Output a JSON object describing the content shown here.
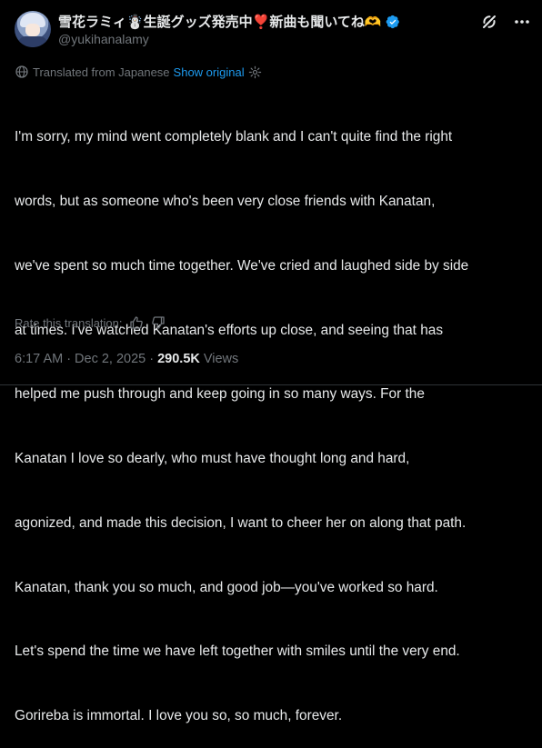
{
  "author": {
    "display_name": "雪花ラミィ☃️生誕グッズ発売中❣️新曲も聞いてね🫶",
    "handle": "@yukihanalamy",
    "verified": true,
    "avatar": "avatar-image"
  },
  "header_actions": [
    {
      "name": "grok-icon",
      "label": ""
    },
    {
      "name": "more-icon",
      "label": ""
    }
  ],
  "translation": {
    "label": "Translated from Japanese",
    "show_original": "Show original",
    "icon": "globe-icon",
    "settings_icon": "gear-icon"
  },
  "tweet": {
    "lines": [
      "I'm sorry, my mind went completely blank and I can't quite find the right",
      "words, but as someone who's been very close friends with Kanatan,",
      "we've spent so much time together. We've cried and laughed side by side",
      "at times. I've watched Kanatan's efforts up close, and seeing that has",
      "helped me push through and keep going in so many ways. For the",
      "Kanatan I love so dearly, who must have thought long and hard,",
      "agonized, and made this decision, I want to cheer her on along that path.",
      "Kanatan, thank you so much, and good job—you've worked so hard.",
      "Let's spend the time we have left together with smiles until the very end.",
      "Gorireba is immortal. I love you so, so much, forever."
    ]
  },
  "rate": {
    "label": "Rate this translation:",
    "like_icon": "thumbs-up-icon",
    "dislike_icon": "thumbs-down-icon"
  },
  "meta": {
    "time": "6:17 AM",
    "separator": "·",
    "date": "Dec 2, 2025",
    "views_count": "290.5K",
    "views_label": "Views"
  },
  "colors": {
    "background": "#000000",
    "text": "#e7e9ea",
    "secondary": "#71767b",
    "accent": "#1d9bf0"
  }
}
